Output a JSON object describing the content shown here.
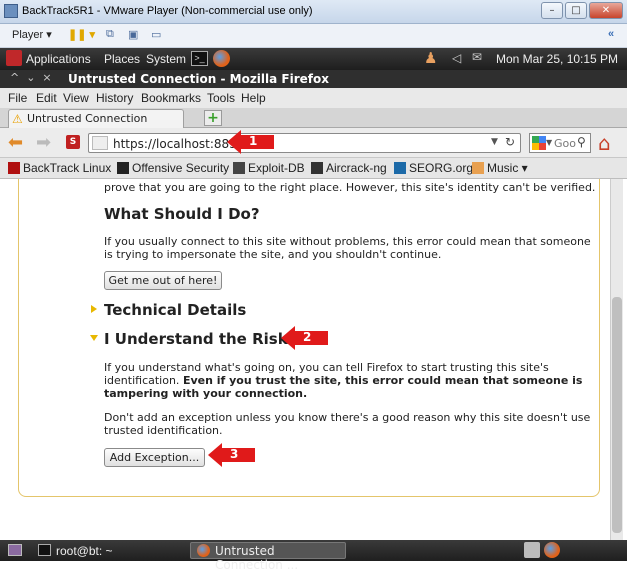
{
  "vmware": {
    "title": "BackTrack5R1 - VMware Player (Non-commercial use only)",
    "player_label": "Player",
    "minimize": "–",
    "maximize": "□",
    "close": "✕",
    "side_arrow": "«"
  },
  "gnome_panel": {
    "menus": [
      "Applications",
      "Places",
      "System"
    ],
    "datetime": "Mon Mar 25, 10:15 PM"
  },
  "firefox": {
    "window_title": "Untrusted Connection - Mozilla Firefox",
    "menus": [
      "File",
      "Edit",
      "View",
      "History",
      "Bookmarks",
      "Tools",
      "Help"
    ],
    "tab_label": "Untrusted Connection",
    "new_tab": "+",
    "url": "https://localhost:8834",
    "search_placeholder": "Goo",
    "bookmarks": [
      "BackTrack Linux",
      "Offensive Security",
      "Exploit-DB",
      "Aircrack-ng",
      "SEORG.org",
      "Music ▾"
    ]
  },
  "content": {
    "top_line": "prove that you are going to the right place. However, this site's identity can't be verified.",
    "what_should_heading": "What Should I Do?",
    "what_should_text_1": "If you usually connect to this site without problems, this error could mean that someone",
    "what_should_text_2": "is trying to impersonate the site, and you shouldn't continue.",
    "get_me_out_button": "Get me out of here!",
    "technical_details_heading": "Technical Details",
    "understand_risks_heading": "I Understand the Risks",
    "risks_text_1": "If you understand what's going on, you can tell Firefox to start trusting this site's",
    "risks_text_2_plain": "identification. ",
    "risks_text_2_bold": "Even if you trust the site, this error could mean that someone is",
    "risks_text_3_bold": "tampering with your connection.",
    "dont_add_text_1": "Don't add an exception unless you know there's a good reason why this site doesn't use",
    "dont_add_text_2": "trusted identification.",
    "add_exception_button": "Add Exception..."
  },
  "annotations": {
    "arrow_1": "1",
    "arrow_2": "2",
    "arrow_3": "3",
    "color": "#e01a1a"
  },
  "taskbar": {
    "terminal_label": "root@bt: ~",
    "firefox_task_label": "Untrusted Connection ..."
  }
}
